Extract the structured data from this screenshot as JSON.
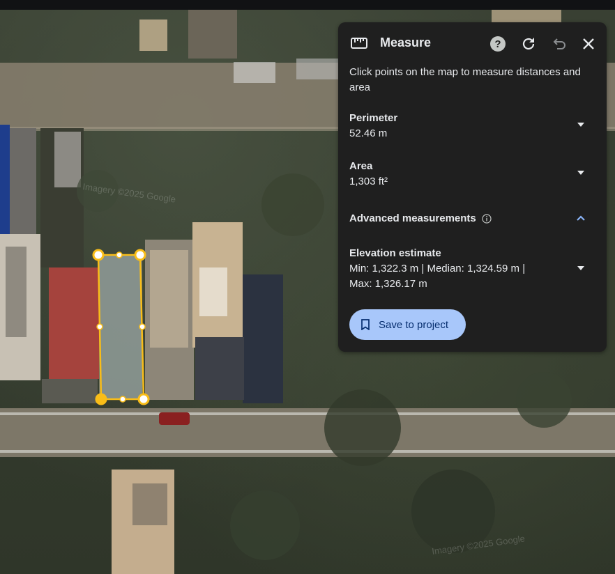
{
  "panel": {
    "title": "Measure",
    "description": "Click points on the map to measure distances and area",
    "perimeter": {
      "label": "Perimeter",
      "value": "52.46 m"
    },
    "area": {
      "label": "Area",
      "value": "1,303 ft²"
    },
    "advanced": {
      "label": "Advanced measurements"
    },
    "elevation": {
      "label": "Elevation estimate",
      "line1": "Min: 1,322.3 m | Median: 1,324.59 m |",
      "line2": "Max: 1,326.17 m"
    },
    "save_label": "Save to project"
  },
  "map": {
    "watermark_top": "Imagery ©2025 Google",
    "watermark_bottom": "Imagery ©2025 Google",
    "measure_color": "#f9bd18"
  },
  "icons": [
    "ruler-icon",
    "help-icon",
    "refresh-icon",
    "undo-icon",
    "close-icon",
    "chevron-down-icon",
    "chevron-up-icon",
    "info-icon",
    "bookmark-icon"
  ]
}
